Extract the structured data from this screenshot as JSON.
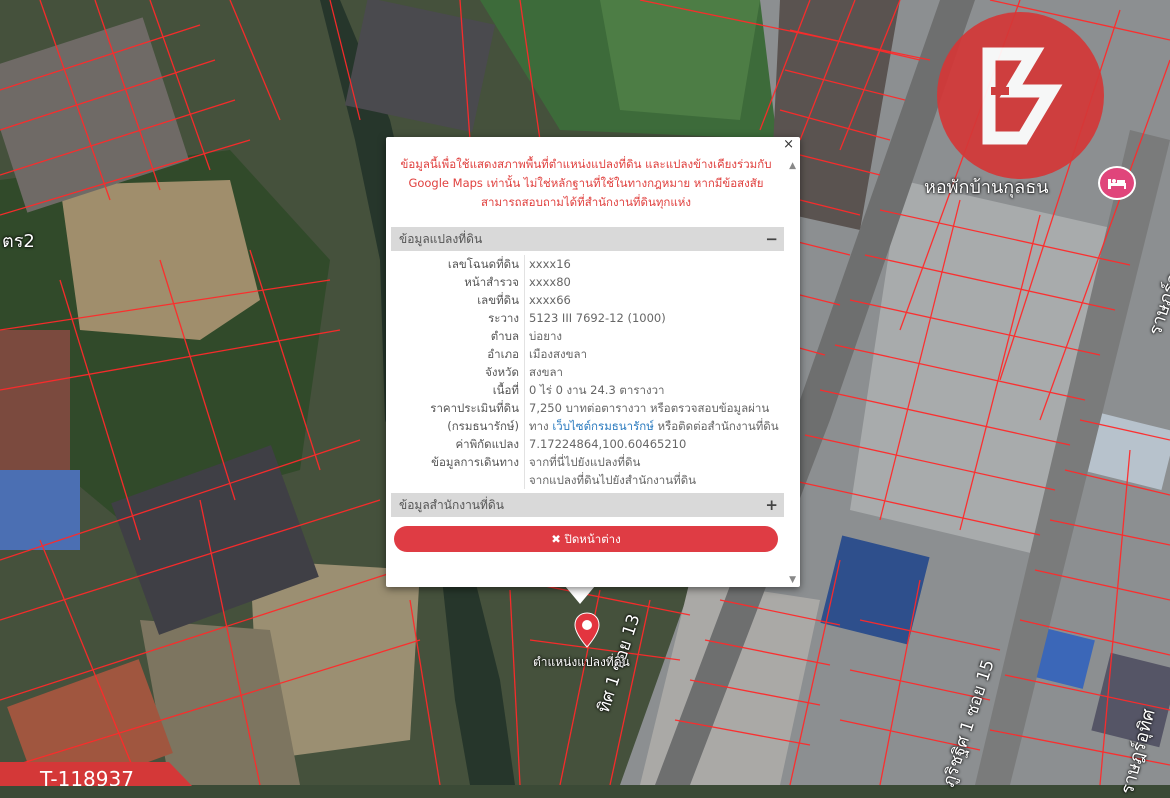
{
  "map": {
    "road_labels": [
      "ตร2",
      "ทิศ 1 ซอย 13",
      "ภูริชฐิศ 1 ซอย 15",
      "ราษฎร์อุทิศ",
      "ราษฎร์อุ"
    ],
    "poi_name": "หอพักบ้านกุลธน",
    "pin_label": "ตำแหน่งแปลงที่ดิน",
    "ref_code": "T-118937",
    "colors": {
      "parcel_line": "#ff2a2a",
      "brand": "#d43838",
      "pin": "#e3353f"
    }
  },
  "popup": {
    "disclaimer": "ข้อมูลนี้เพื่อใช้แสดงสภาพพื้นที่ตำแหน่งแปลงที่ดิน และแปลงข้างเคียงร่วมกับ Google Maps เท่านั้น ไม่ใช่หลักฐานที่ใช้ในทางกฎหมาย หากมีข้อสงสัยสามารถสอบถามได้ที่สำนักงานที่ดินทุกแห่ง",
    "close_symbol": "×",
    "section1_title": "ข้อมูลแปลงที่ดิน",
    "section1_sign": "−",
    "section2_title": "ข้อมูลสำนักงานที่ดิน",
    "section2_sign": "+",
    "fields": {
      "deed_no": {
        "label": "เลขโฉนดที่ดิน",
        "value": "xxxx16"
      },
      "survey_page": {
        "label": "หน้าสำรวจ",
        "value": "xxxx80"
      },
      "land_no": {
        "label": "เลขที่ดิน",
        "value": "xxxx66"
      },
      "map_sheet": {
        "label": "ระวาง",
        "value": "5123 III 7692-12 (1000)"
      },
      "subdistrict": {
        "label": "ตำบล",
        "value": "บ่อยาง"
      },
      "district": {
        "label": "อำเภอ",
        "value": "เมืองสงขลา"
      },
      "province": {
        "label": "จังหวัด",
        "value": "สงขลา"
      },
      "area": {
        "label": "เนื้อที่",
        "value": "0 ไร่ 0 งาน 24.3 ตารางวา"
      },
      "appraisal": {
        "label1": "ราคาประเมินที่ดิน",
        "label2": "(กรมธนารักษ์)",
        "line1": "7,250 บาทต่อตารางวา หรือตรวจสอบข้อมูลผ่าน",
        "line2_prefix": "ทาง ",
        "line2_link": "เว็บไซต์กรมธนารักษ์",
        "line2_suffix": " หรือติดต่อสำนักงานที่ดิน"
      },
      "coordinates": {
        "label": "ค่าพิกัดแปลง",
        "value": "7.17224864,100.60465210"
      },
      "directions": {
        "label": "ข้อมูลการเดินทาง",
        "link1": "จากที่นี่ไปยังแปลงที่ดิน",
        "link2": "จากแปลงที่ดินไปยังสำนักงานที่ดิน"
      }
    },
    "close_button_icon": "✖",
    "close_button_label": "ปิดหน้าต่าง"
  }
}
